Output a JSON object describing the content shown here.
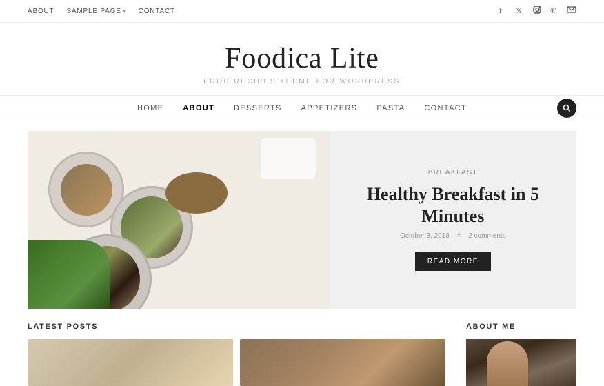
{
  "topbar": {
    "nav": [
      {
        "label": "ABOUT",
        "href": "#"
      },
      {
        "label": "SAMPLE PAGE",
        "hasDropdown": true
      },
      {
        "label": "CONTACT",
        "href": "#"
      }
    ],
    "social": [
      {
        "name": "facebook-icon",
        "symbol": "f"
      },
      {
        "name": "twitter-icon",
        "symbol": "t"
      },
      {
        "name": "instagram-icon",
        "symbol": "◻"
      },
      {
        "name": "pinterest-icon",
        "symbol": "p"
      },
      {
        "name": "email-icon",
        "symbol": "✉"
      }
    ]
  },
  "siteheader": {
    "title": "Foodica Lite",
    "tagline": "FOOD RECIPES THEME FOR WORDPRESS"
  },
  "mainnav": {
    "links": [
      {
        "label": "HOME",
        "active": false
      },
      {
        "label": "ABOUT",
        "active": true
      },
      {
        "label": "DESSERTS",
        "active": false
      },
      {
        "label": "APPETIZERS",
        "active": false
      },
      {
        "label": "PASTA",
        "active": false
      },
      {
        "label": "CONTACT",
        "active": false
      }
    ],
    "search_label": "🔍"
  },
  "hero": {
    "category": "Breakfast",
    "title": "Healthy Breakfast in 5 Minutes",
    "date": "October 3, 2018",
    "separator": "×",
    "comments": "2 comments",
    "cta": "READ MORE"
  },
  "bottomsection": {
    "latest_posts_title": "LATEST POSTS",
    "about_me_title": "ABOUT ME"
  }
}
